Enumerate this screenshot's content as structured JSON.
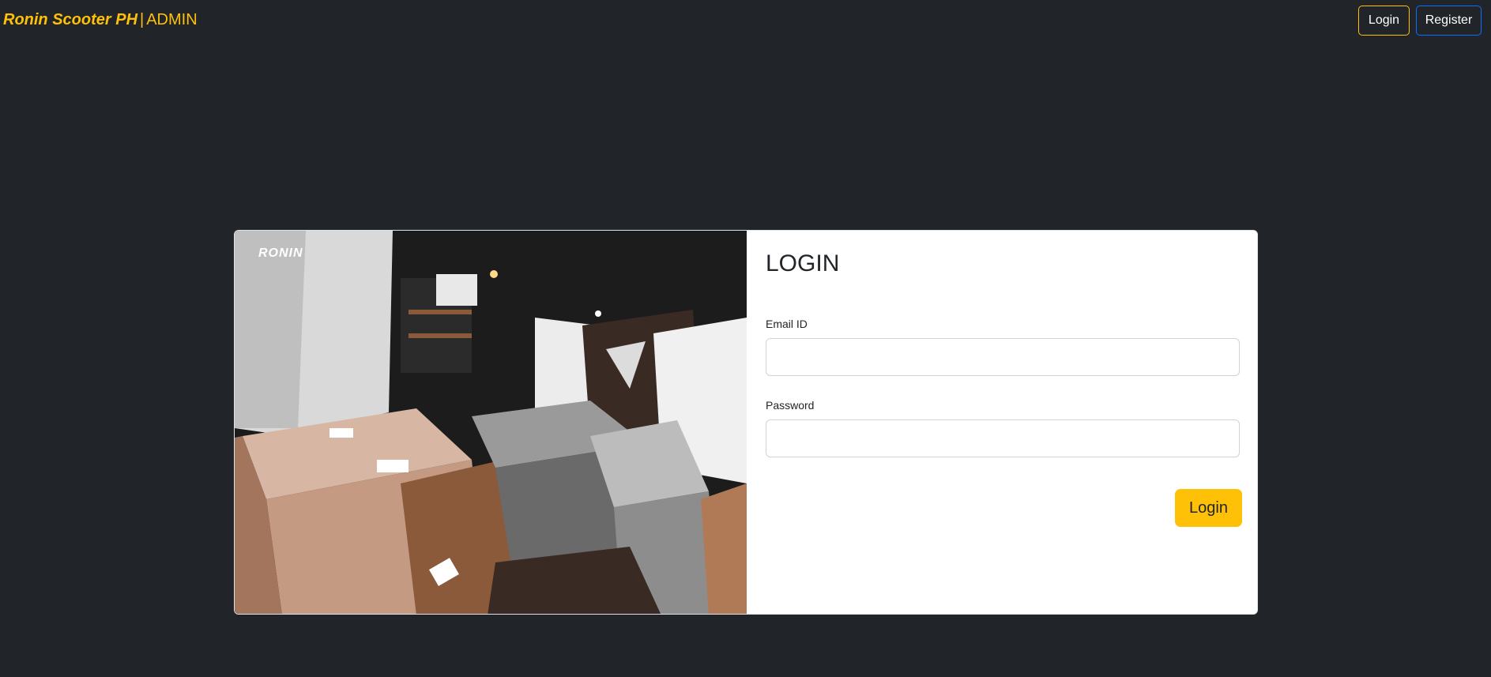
{
  "navbar": {
    "brand_name": "Ronin Scooter PH",
    "brand_sep": "|",
    "brand_suffix": "ADMIN",
    "login_label": "Login",
    "register_label": "Register"
  },
  "hero": {
    "logo_text": "RONIN"
  },
  "form": {
    "title": "LOGIN",
    "email_label": "Email ID",
    "email_value": "",
    "password_label": "Password",
    "password_value": "",
    "submit_label": "Login"
  },
  "colors": {
    "background": "#212529",
    "accent": "#ffc107",
    "register_border": "#0d6efd",
    "card": "#ffffff"
  }
}
